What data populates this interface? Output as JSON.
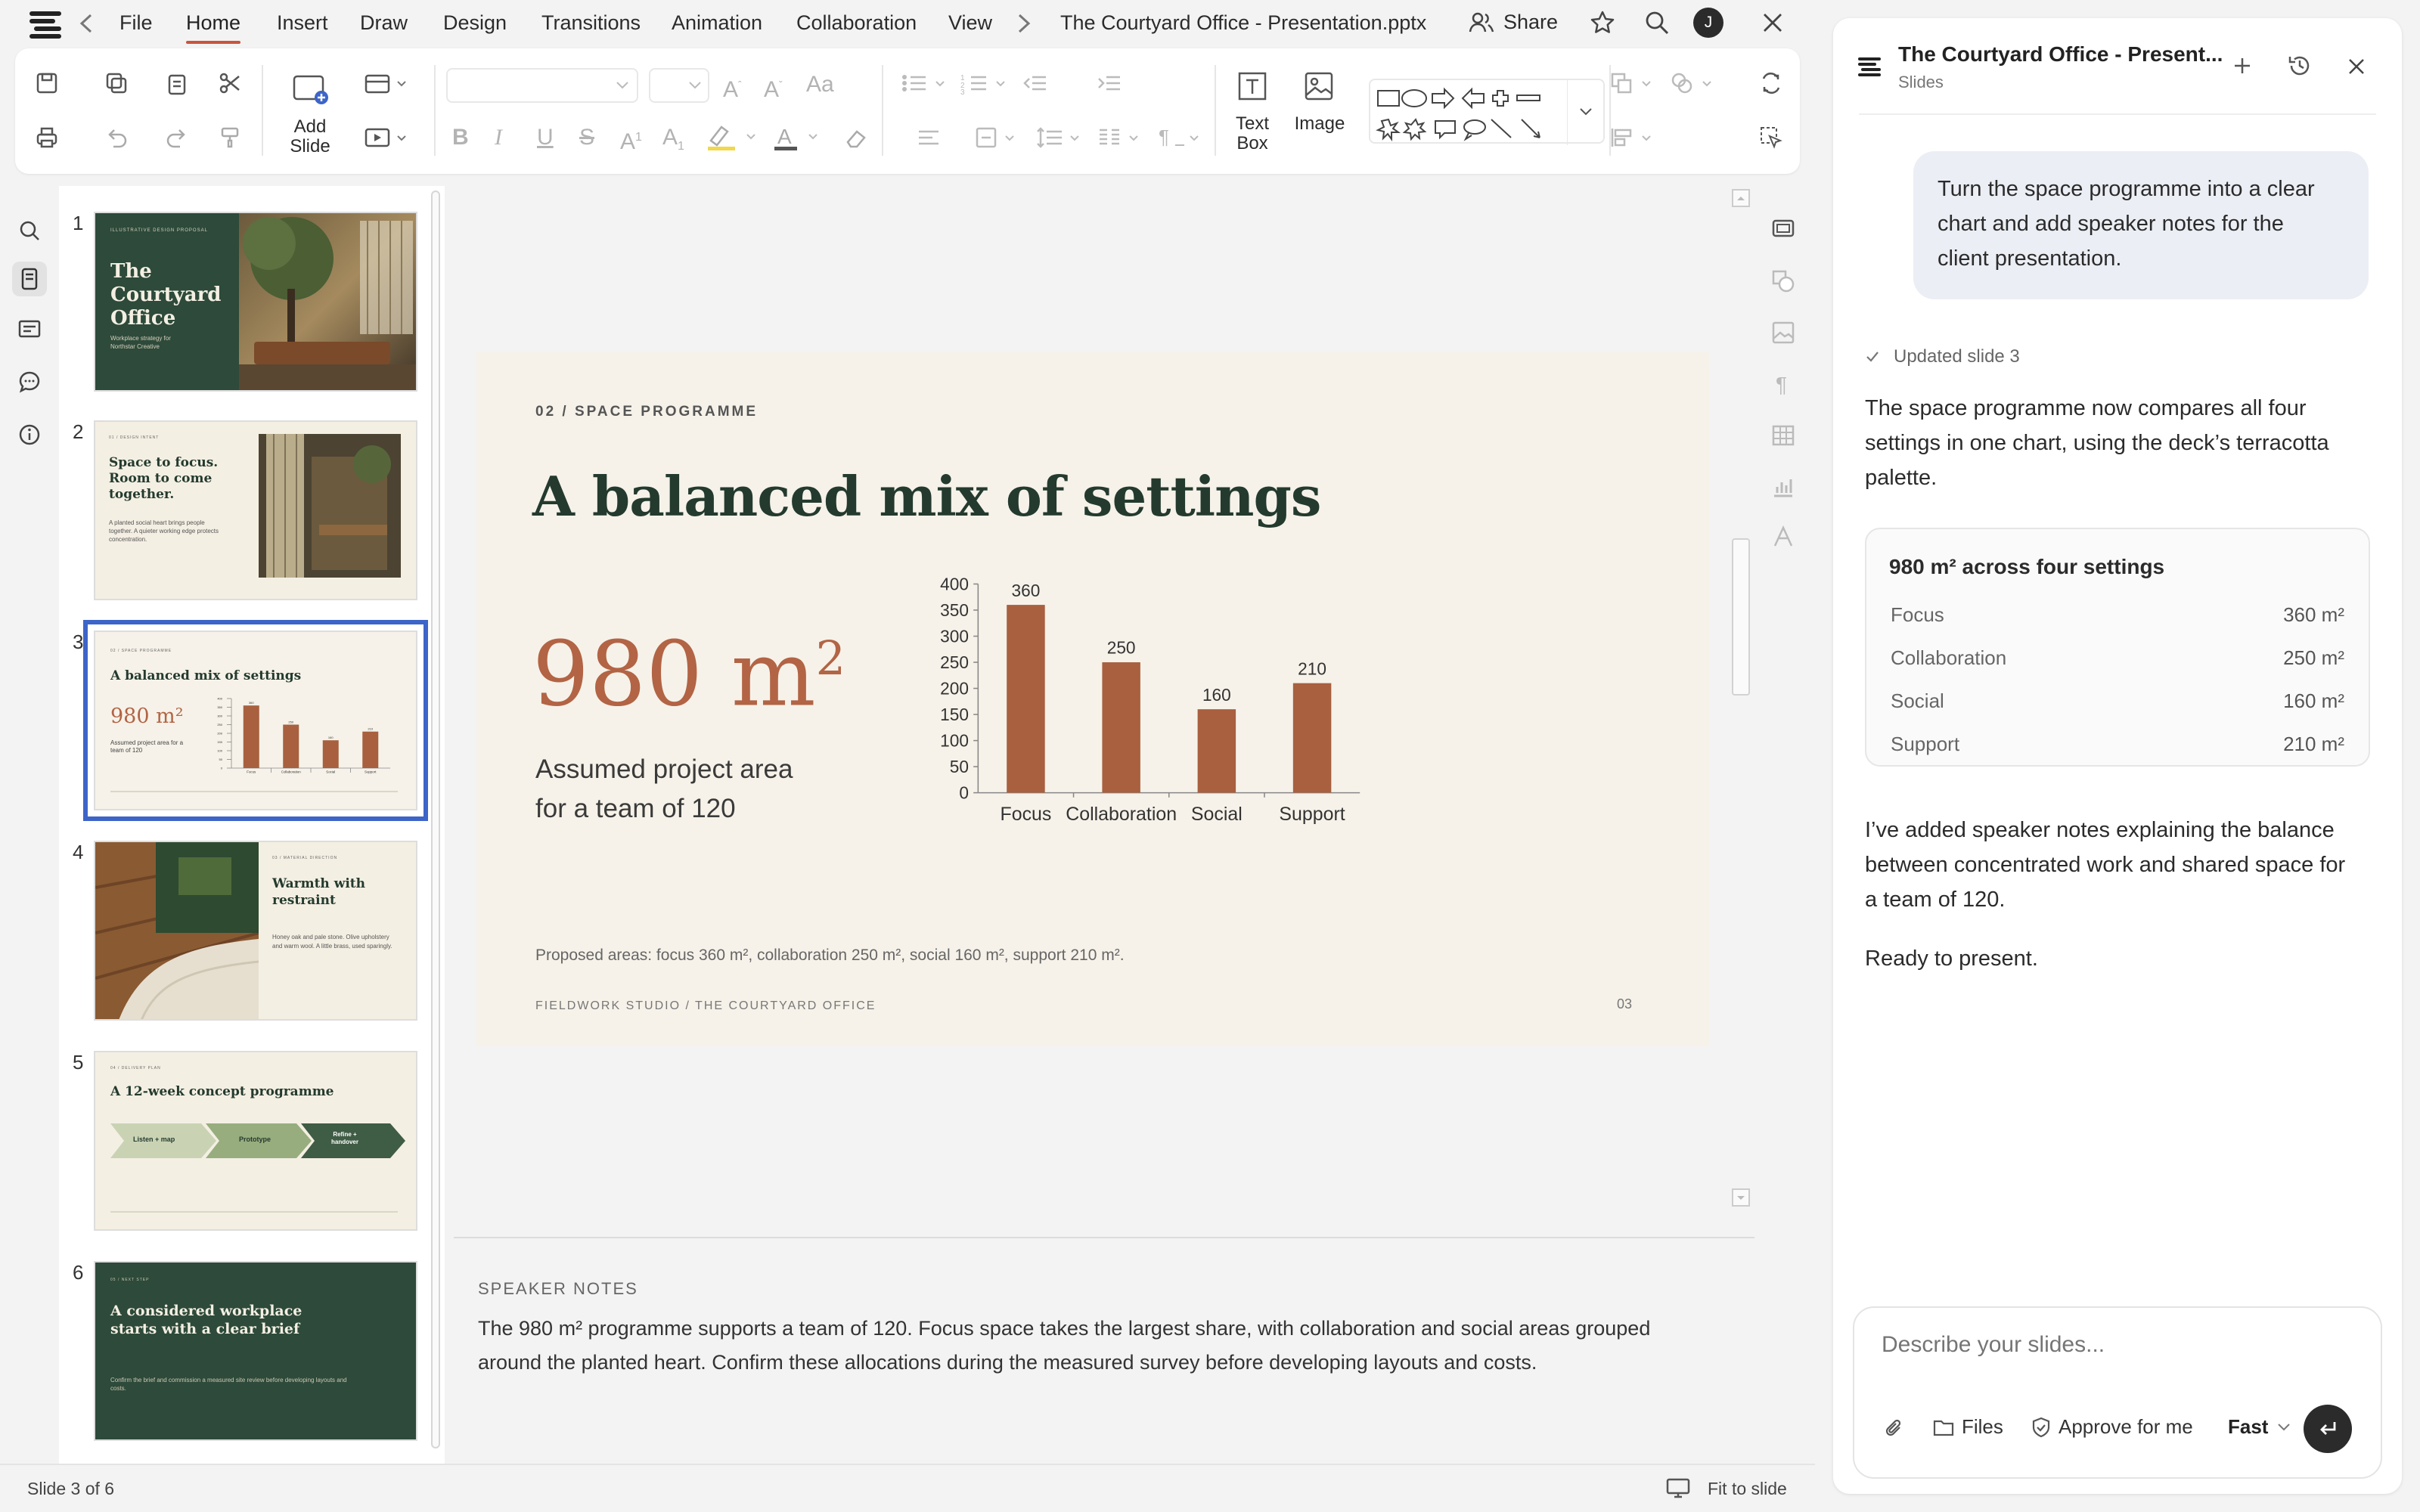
{
  "app": {
    "title": "The Courtyard Office - Presentation.pptx",
    "share_label": "Share",
    "user_initial": "J"
  },
  "menu": {
    "items": [
      "File",
      "Home",
      "Insert",
      "Draw",
      "Design",
      "Transitions",
      "Animation",
      "Collaboration",
      "View"
    ],
    "active": "Home"
  },
  "ribbon": {
    "add_slide_label": "Add",
    "add_slide_label2": "Slide",
    "text_box_label": "Text",
    "text_box_label2": "Box",
    "image_label": "Image"
  },
  "thumbnails": [
    {
      "num": "1",
      "kicker": "ILLUSTRATIVE DESIGN PROPOSAL",
      "title": "The Courtyard Office",
      "sub": "Workplace strategy for Northstar Creative"
    },
    {
      "num": "2",
      "kicker": "01 / DESIGN INTENT",
      "title": "Space to focus. Room to come together.",
      "sub": "A planted social heart brings people together. A quieter working edge protects concentration."
    },
    {
      "num": "3",
      "kicker": "02 / SPACE PROGRAMME",
      "title": "A balanced mix of settings",
      "big": "980 m²",
      "sub": "Assumed project area for a team of 120"
    },
    {
      "num": "4",
      "kicker": "03 / MATERIAL DIRECTION",
      "title": "Warmth with restraint",
      "sub": "Honey oak and pale stone. Olive upholstery and warm wool. A little brass, used sparingly."
    },
    {
      "num": "5",
      "kicker": "04 / DELIVERY PLAN",
      "title": "A 12-week concept programme",
      "steps": [
        "Listen + map",
        "Prototype",
        "Refine + handover"
      ]
    },
    {
      "num": "6",
      "kicker": "05 / NEXT STEP",
      "title": "A considered workplace starts with a clear brief",
      "sub": "Confirm the brief and commission a measured site review before developing layouts and costs."
    }
  ],
  "slide": {
    "kicker": "02 / SPACE PROGRAMME",
    "title": "A balanced mix of settings",
    "big_number": "980 m",
    "big_sup": "2",
    "area_caption_1": "Assumed project area",
    "area_caption_2": "for a team of 120",
    "footnote": "Proposed areas: focus 360 m², collaboration 250 m², social 160 m², support 210 m².",
    "footer": "FIELDWORK STUDIO / THE COURTYARD OFFICE",
    "page": "03"
  },
  "chart_data": {
    "type": "bar",
    "categories": [
      "Focus",
      "Collaboration",
      "Social",
      "Support"
    ],
    "values": [
      360,
      250,
      160,
      210
    ],
    "ylim": [
      0,
      400
    ],
    "yticks": [
      0,
      50,
      100,
      150,
      200,
      250,
      300,
      350,
      400
    ],
    "bar_color": "#a8603f",
    "data_labels": true,
    "grid": false
  },
  "notes": {
    "heading": "SPEAKER NOTES",
    "line1": "The 980 m² programme supports a team of 120. Focus space takes the largest share, with collaboration and social areas grouped",
    "line2": "around the planted heart. Confirm these allocations during the measured survey before developing layouts and costs."
  },
  "status": {
    "slide_count": "Slide 3 of 6",
    "fit": "Fit to slide"
  },
  "panel": {
    "title": "The Courtyard Office - Present...",
    "subtitle": "Slides",
    "user_msg_1": "Turn the space programme into a clear",
    "user_msg_2": "chart and add speaker notes for the",
    "user_msg_3": "client presentation.",
    "updated": "Updated slide 3",
    "reply1_1": "The space programme now compares all four",
    "reply1_2": "settings in one chart, using the deck’s terracotta",
    "reply1_3": "palette.",
    "card_title": "980 m² across four settings",
    "card_rows": [
      {
        "label": "Focus",
        "value": "360 m²"
      },
      {
        "label": "Collaboration",
        "value": "250 m²"
      },
      {
        "label": "Social",
        "value": "160 m²"
      },
      {
        "label": "Support",
        "value": "210 m²"
      }
    ],
    "reply2_1": "I’ve added speaker notes explaining the balance",
    "reply2_2": "between concentrated work and shared space for",
    "reply2_3": "a team of 120.",
    "reply3": "Ready to present.",
    "input_placeholder": "Describe your slides...",
    "files_label": "Files",
    "approve_label": "Approve for me",
    "mode_label": "Fast"
  },
  "colors": {
    "accent": "#c8553d",
    "terracotta": "#a8603f",
    "dark_green": "#2d4a3a",
    "selection": "#3d64c8"
  }
}
